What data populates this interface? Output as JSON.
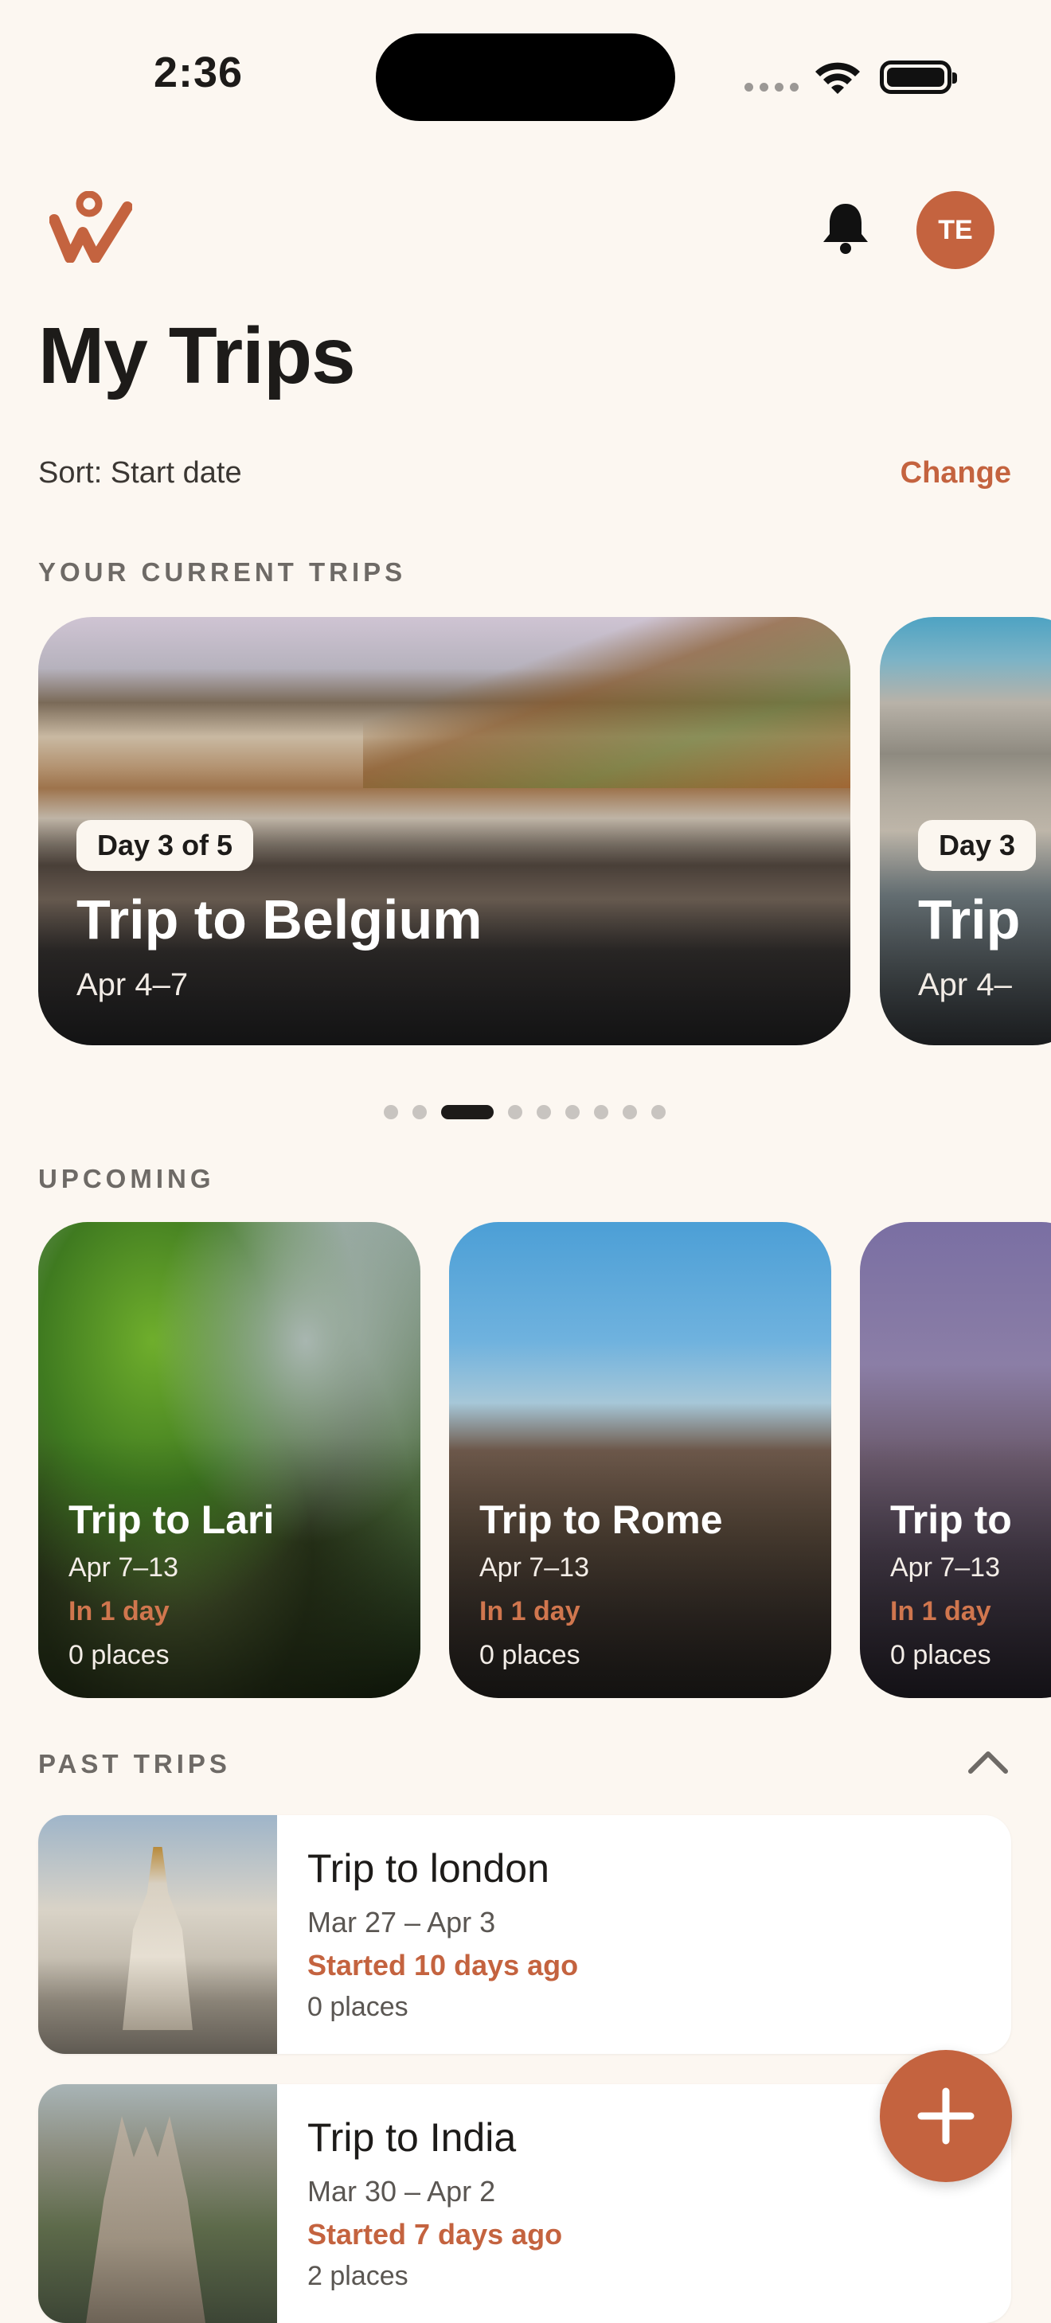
{
  "status_bar": {
    "time": "2:36"
  },
  "header": {
    "avatar_initials": "TE"
  },
  "page": {
    "title": "My Trips",
    "sort_label": "Sort: Start date",
    "change_label": "Change"
  },
  "sections": {
    "current": "YOUR CURRENT TRIPS",
    "upcoming": "UPCOMING",
    "past": "PAST TRIPS"
  },
  "current_trips": [
    {
      "day": "Day 3 of 5",
      "title": "Trip to Belgium",
      "dates": "Apr 4–7"
    },
    {
      "day": "Day 3",
      "title": "Trip",
      "dates": "Apr 4–"
    }
  ],
  "carousel": {
    "dot_count": 9,
    "active_index": 2
  },
  "upcoming_trips": [
    {
      "title": "Trip to Lari",
      "dates": "Apr 7–13",
      "status": "In 1 day",
      "places": "0 places"
    },
    {
      "title": "Trip to Rome",
      "dates": "Apr 7–13",
      "status": "In 1 day",
      "places": "0 places"
    },
    {
      "title": "Trip to",
      "dates": "Apr 7–13",
      "status": "In 1 day",
      "places": "0 places"
    }
  ],
  "past_trips": [
    {
      "title": "Trip to london",
      "dates": "Mar 27 – Apr 3",
      "status": "Started 10 days ago",
      "places": "0 places"
    },
    {
      "title": "Trip to India",
      "dates": "Mar 30 – Apr 2",
      "status": "Started 7 days ago",
      "places": "2 places"
    }
  ],
  "icons": {
    "logo": "wanderlog-logo-icon",
    "bell": "bell-icon",
    "chevron": "chevron-up-icon",
    "fab": "plus-icon"
  },
  "colors": {
    "accent": "#c4633f",
    "background": "#fcf7f1"
  }
}
